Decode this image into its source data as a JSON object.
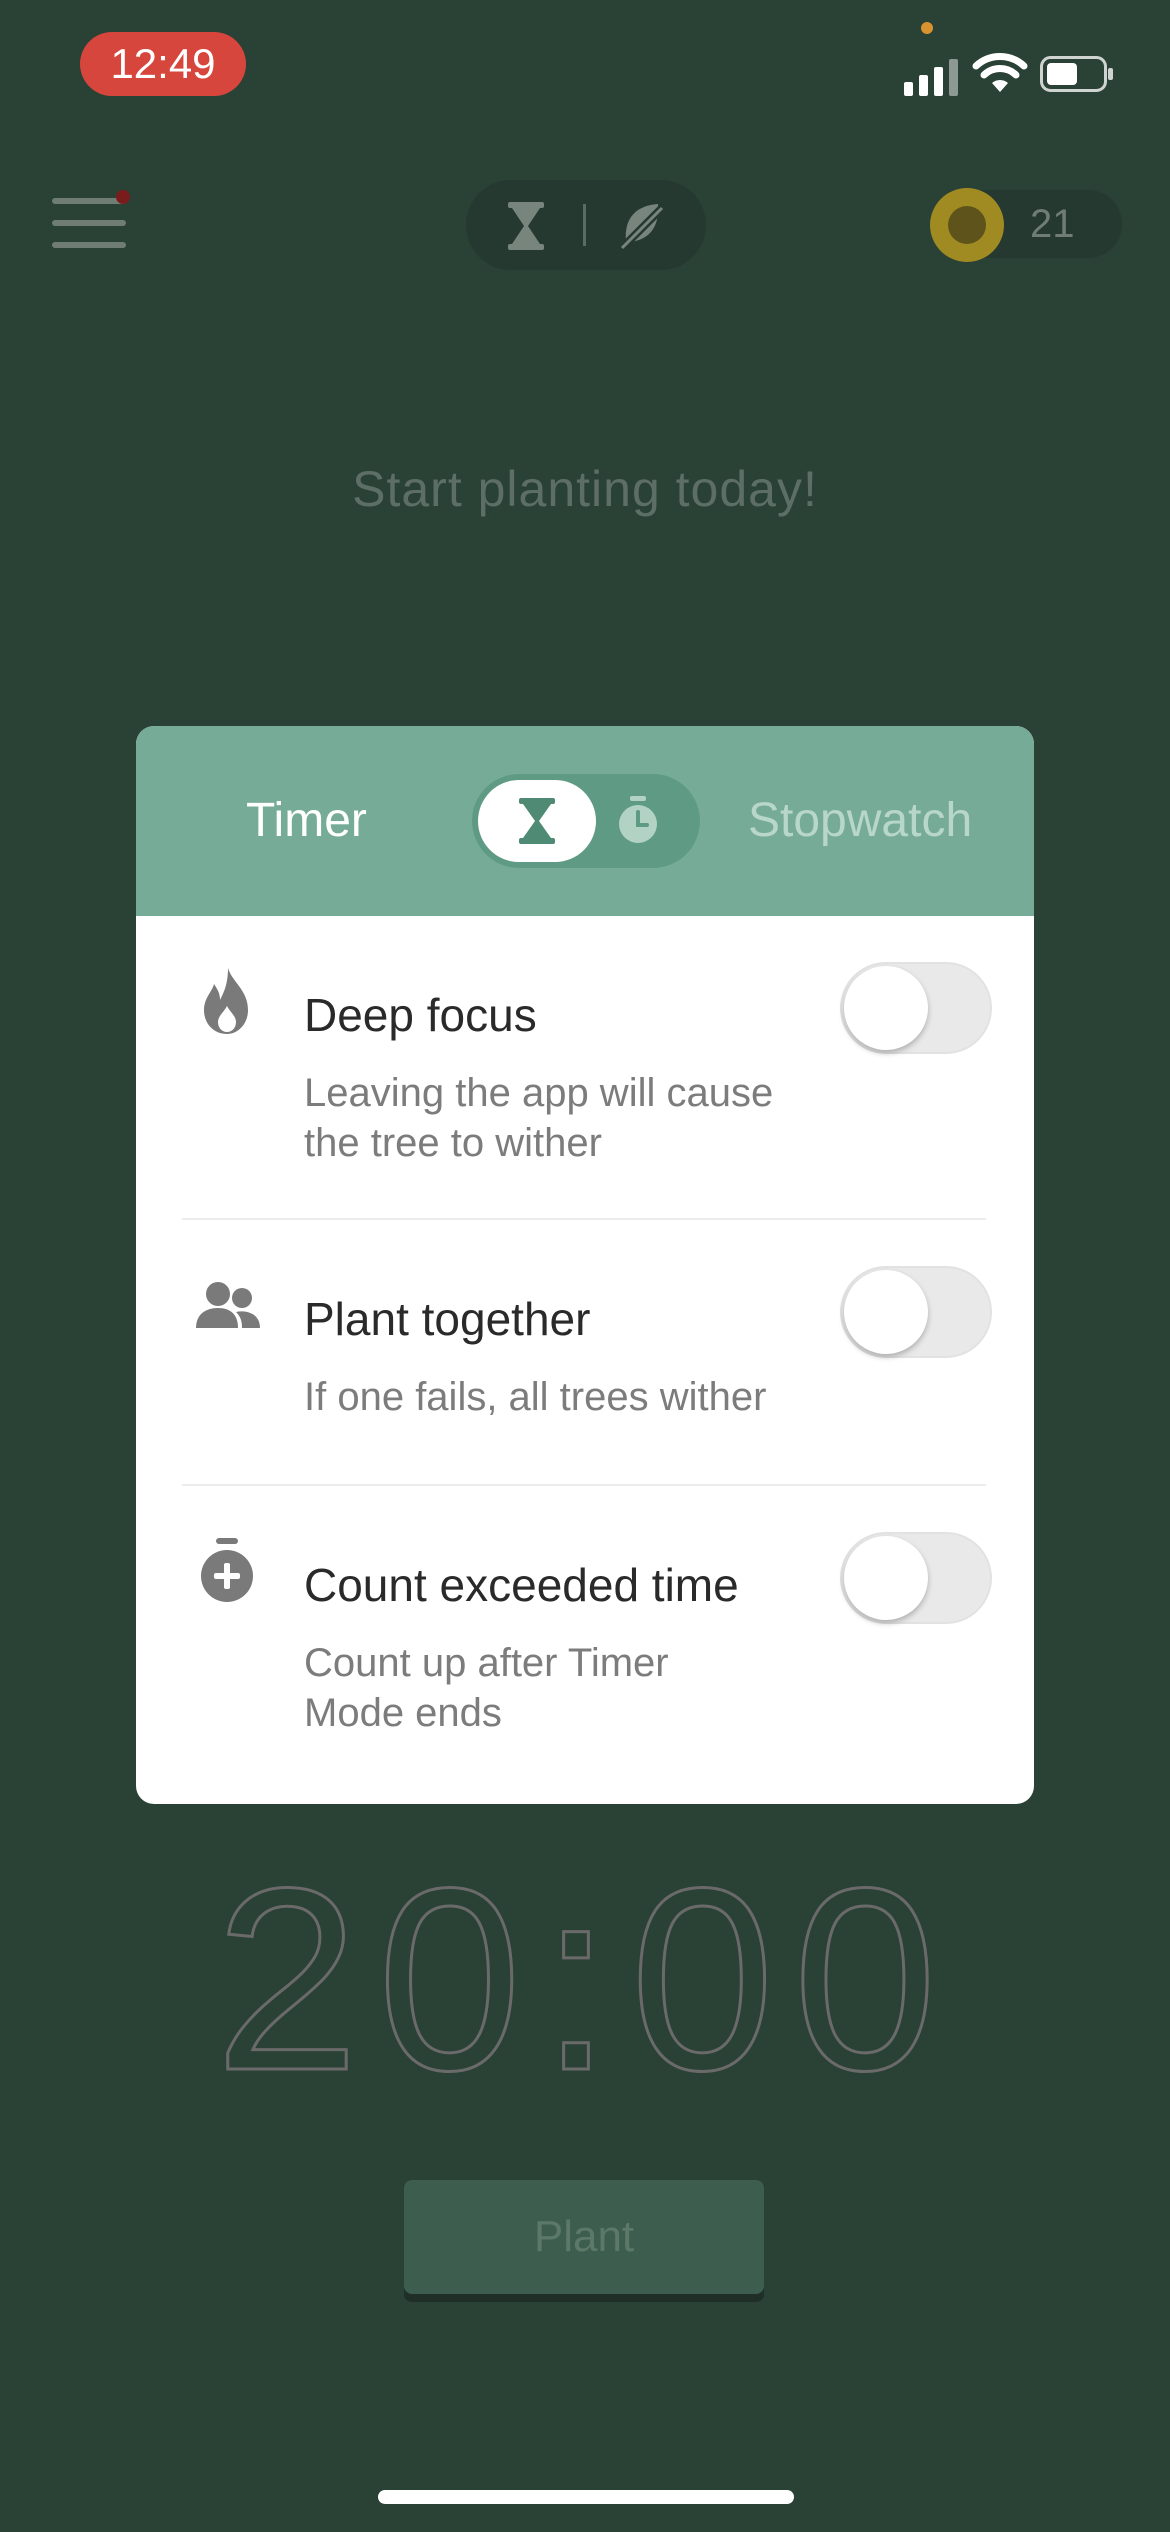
{
  "status_bar": {
    "time": "12:49"
  },
  "header": {
    "coin_count": "21"
  },
  "tagline": "Start planting today!",
  "mode_card": {
    "tab_timer": "Timer",
    "tab_stopwatch": "Stopwatch",
    "selected_mode": "Timer",
    "options": [
      {
        "title": "Deep focus",
        "desc_line1": "Leaving the app will cause",
        "desc_line2": "the tree to wither",
        "enabled": false
      },
      {
        "title": "Plant together",
        "desc_line1": "If one fails, all trees wither",
        "enabled": false
      },
      {
        "title": "Count exceeded time",
        "desc_line1": "Count up after Timer",
        "desc_line2": "Mode ends",
        "enabled": false
      }
    ]
  },
  "timer": {
    "display": "20:00"
  },
  "plant_button": {
    "label": "Plant"
  },
  "colors": {
    "background": "#2a4136",
    "card_header": "#76ac97",
    "accent": "#3d7a63"
  }
}
